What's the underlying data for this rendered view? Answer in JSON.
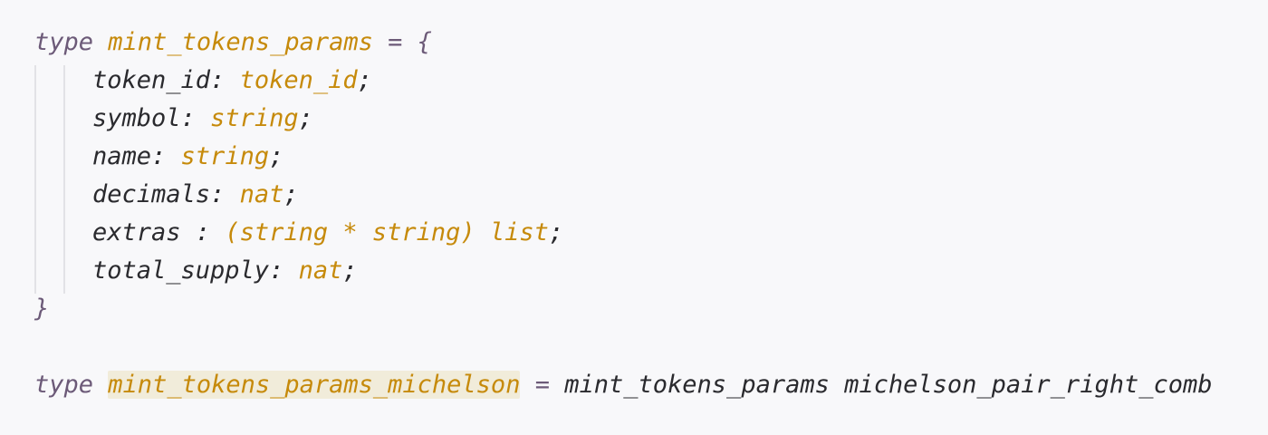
{
  "code": {
    "block1": {
      "keyword": "type",
      "type_name": "mint_tokens_params",
      "assign": "= {",
      "fields": [
        {
          "name": "token_id:",
          "type": "token_id",
          "end": ";"
        },
        {
          "name": "symbol:",
          "type": "string",
          "end": ";"
        },
        {
          "name": "name:",
          "type": "string",
          "end": ";"
        },
        {
          "name": "decimals:",
          "type": "nat",
          "end": ";"
        },
        {
          "name": "extras :",
          "type": "(string * string) list",
          "end": ";"
        },
        {
          "name": "total_supply:",
          "type": "nat",
          "end": ";"
        }
      ],
      "close": "}"
    },
    "block2": {
      "keyword": "type",
      "type_name": "mint_tokens_params_michelson",
      "assign": "=",
      "value": "mint_tokens_params michelson_pair_right_comb"
    }
  },
  "colors": {
    "background": "#f8f8fa",
    "keyword": "#6c5a78",
    "type": "#c68a0b",
    "text": "#2a2a2e",
    "highlight": "#f1ecda"
  }
}
